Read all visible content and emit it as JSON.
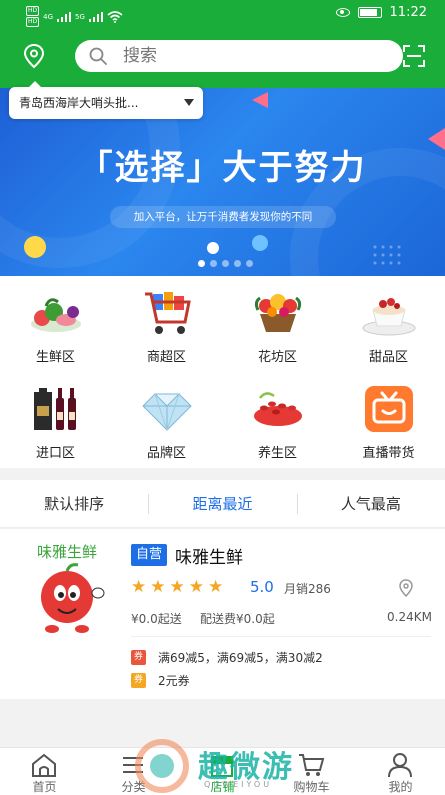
{
  "status_bar": {
    "left_labels": [
      "HD",
      "4G",
      "HD",
      "5G"
    ],
    "time": "11:22"
  },
  "header": {
    "search_placeholder": "搜索",
    "location": "青岛西海岸大哨头批..."
  },
  "banner": {
    "title": "「选择」大于努力",
    "subtitle": "加入平台，让万千消费者发现你的不同",
    "dots_count": 5,
    "active_dot": 0
  },
  "categories": [
    {
      "label": "生鲜区",
      "icon": "fresh-produce-icon"
    },
    {
      "label": "商超区",
      "icon": "shopping-cart-icon"
    },
    {
      "label": "花坊区",
      "icon": "flower-basket-icon"
    },
    {
      "label": "甜品区",
      "icon": "dessert-icon"
    },
    {
      "label": "进口区",
      "icon": "wine-icon"
    },
    {
      "label": "品牌区",
      "icon": "diamond-icon"
    },
    {
      "label": "养生区",
      "icon": "goji-berry-icon"
    },
    {
      "label": "直播带货",
      "icon": "live-tv-icon"
    }
  ],
  "sort": {
    "items": [
      "默认排序",
      "距离最近",
      "人气最高"
    ],
    "active_index": 1
  },
  "store": {
    "badge": "自营",
    "name": "味雅生鲜",
    "logo_text": "味雅生鲜",
    "rating": 5,
    "score": "5.0",
    "monthly_sales": "月销286",
    "min_order": "¥0.0起送",
    "delivery_fee": "配送费¥0.0起",
    "distance": "0.24KM",
    "promos": [
      {
        "tag": "券",
        "text": "满69减5，满69减5，满30减2",
        "color": "#e8563c"
      },
      {
        "tag": "券",
        "text": "2元券",
        "color": "#f5a623"
      }
    ]
  },
  "bottom_nav": {
    "items": [
      {
        "label": "首页",
        "icon": "home-icon"
      },
      {
        "label": "分类",
        "icon": "category-icon"
      },
      {
        "label": "店铺",
        "icon": "store-icon"
      },
      {
        "label": "购物车",
        "icon": "cart-icon"
      },
      {
        "label": "我的",
        "icon": "user-icon"
      }
    ],
    "active_index": 2
  },
  "watermark": {
    "text": "趣微游",
    "sub": "QUWEIYOU"
  },
  "colors": {
    "brand_green": "#1aad3a",
    "accent_blue": "#1e6fe6",
    "star": "#f5a623"
  }
}
